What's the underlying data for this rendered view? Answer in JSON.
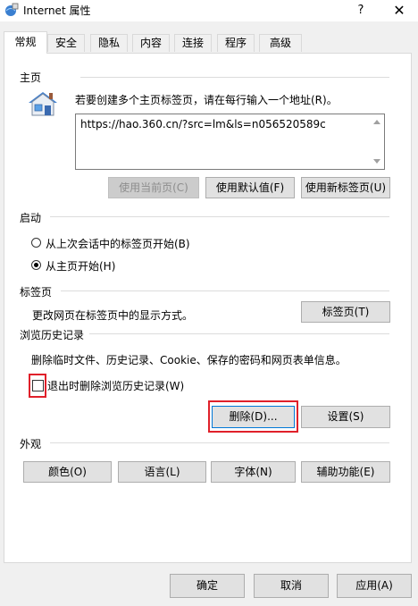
{
  "window": {
    "title": "Internet 属性",
    "help_glyph": "?",
    "close_glyph": "✕"
  },
  "tabs": [
    {
      "label": "常规",
      "active": true
    },
    {
      "label": "安全"
    },
    {
      "label": "隐私"
    },
    {
      "label": "内容"
    },
    {
      "label": "连接"
    },
    {
      "label": "程序"
    },
    {
      "label": "高级"
    }
  ],
  "homepage": {
    "section_title": "主页",
    "instruction": "若要创建多个主页标签页，请在每行输入一个地址(R)。",
    "url": "https://hao.360.cn/?src=lm&ls=n056520589c",
    "use_current_label": "使用当前页(C)",
    "use_default_label": "使用默认值(F)",
    "use_new_tab_label": "使用新标签页(U)"
  },
  "startup": {
    "section_title": "启动",
    "option_last_session": "从上次会话中的标签页开始(B)",
    "option_homepage": "从主页开始(H)",
    "selected": "homepage"
  },
  "tabs_section": {
    "section_title": "标签页",
    "description": "更改网页在标签页中的显示方式。",
    "button_label": "标签页(T)"
  },
  "history": {
    "section_title": "浏览历史记录",
    "description": "删除临时文件、历史记录、Cookie、保存的密码和网页表单信息。",
    "delete_on_exit_label": "退出时删除浏览历史记录(W)",
    "delete_on_exit_checked": false,
    "delete_label": "删除(D)...",
    "settings_label": "设置(S)"
  },
  "appearance": {
    "section_title": "外观",
    "colors_label": "颜色(O)",
    "languages_label": "语言(L)",
    "fonts_label": "字体(N)",
    "accessibility_label": "辅助功能(E)"
  },
  "footer": {
    "ok_label": "确定",
    "cancel_label": "取消",
    "apply_label": "应用(A)"
  },
  "colors": {
    "highlight_red": "#e0202a",
    "focus_blue": "#0078d7"
  }
}
